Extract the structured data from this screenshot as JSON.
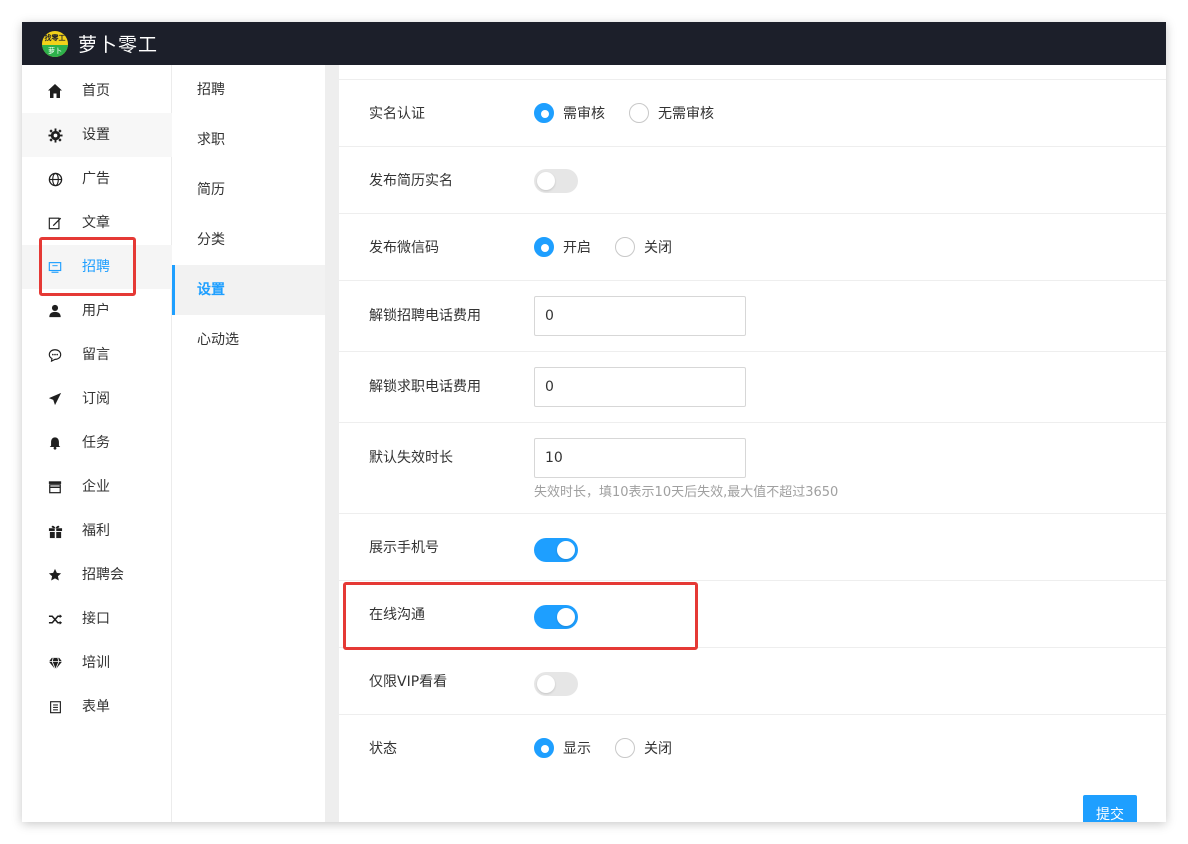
{
  "app": {
    "title": "萝卜零工",
    "logo_top": "找零工",
    "logo_bottom": "萝卜"
  },
  "sidebar": {
    "items": [
      {
        "icon": "home-icon",
        "label": "首页"
      },
      {
        "icon": "gear-icon",
        "label": "设置"
      },
      {
        "icon": "globe-icon",
        "label": "广告"
      },
      {
        "icon": "edit-icon",
        "label": "文章"
      },
      {
        "icon": "recruit-icon",
        "label": "招聘"
      },
      {
        "icon": "user-icon",
        "label": "用户"
      },
      {
        "icon": "comment-icon",
        "label": "留言"
      },
      {
        "icon": "send-icon",
        "label": "订阅"
      },
      {
        "icon": "bell-icon",
        "label": "任务"
      },
      {
        "icon": "store-icon",
        "label": "企业"
      },
      {
        "icon": "gift-icon",
        "label": "福利"
      },
      {
        "icon": "star-icon",
        "label": "招聘会"
      },
      {
        "icon": "shuffle-icon",
        "label": "接口"
      },
      {
        "icon": "diamond-icon",
        "label": "培训"
      },
      {
        "icon": "form-icon",
        "label": "表单"
      }
    ],
    "active": "招聘"
  },
  "subnav": {
    "items": [
      "招聘",
      "求职",
      "简历",
      "分类",
      "设置",
      "心动选"
    ],
    "active": "设置"
  },
  "settings": {
    "real_name": {
      "label": "实名认证",
      "options": [
        "需审核",
        "无需审核"
      ],
      "selected": "需审核"
    },
    "resume_real_name": {
      "label": "发布简历实名",
      "enabled": false
    },
    "wechat_code": {
      "label": "发布微信码",
      "options": [
        "开启",
        "关闭"
      ],
      "selected": "开启"
    },
    "unlock_recruit_fee": {
      "label": "解锁招聘电话费用",
      "value": "0"
    },
    "unlock_job_fee": {
      "label": "解锁求职电话费用",
      "value": "0"
    },
    "default_expiry": {
      "label": "默认失效时长",
      "value": "10",
      "hint": "失效时长，填10表示10天后失效,最大值不超过3650"
    },
    "show_phone": {
      "label": "展示手机号",
      "enabled": true
    },
    "online_chat": {
      "label": "在线沟通",
      "enabled": true
    },
    "vip_only": {
      "label": "仅限VIP看看",
      "enabled": false
    },
    "status": {
      "label": "状态",
      "options": [
        "显示",
        "关闭"
      ],
      "selected": "显示"
    },
    "submit_label": "提交"
  },
  "colors": {
    "topbar": "#1c1f2a",
    "accent": "#1e9fff",
    "highlight": "#e53935"
  }
}
